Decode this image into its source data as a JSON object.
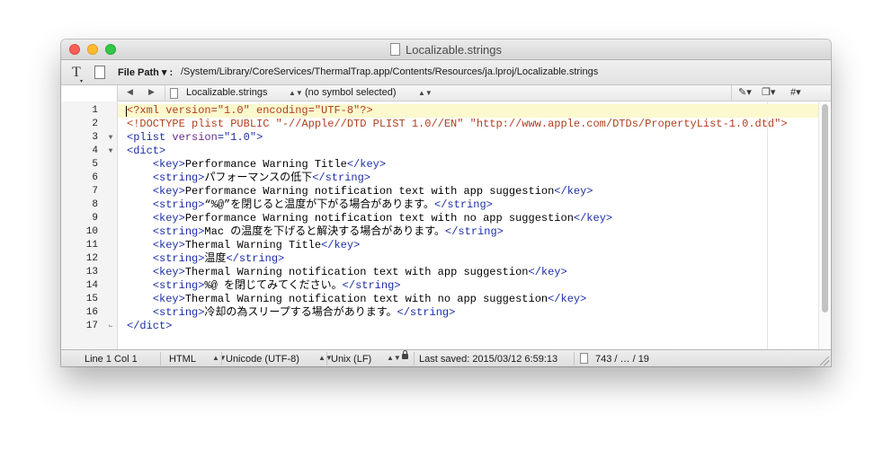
{
  "window": {
    "title": "Localizable.strings"
  },
  "pathbar": {
    "label": "File Path ▾ :",
    "value": "/System/Library/CoreServices/ThermalTrap.app/Contents/Resources/ja.lproj/Localizable.strings"
  },
  "navbar": {
    "file_name": "Localizable.strings",
    "symbol": "(no symbol selected)",
    "tool_icons": [
      "pencil-icon",
      "document-copy-icon",
      "hash-icon"
    ]
  },
  "editor": {
    "lines": [
      {
        "n": "1",
        "fold": "",
        "current": true,
        "tokens": [
          {
            "c": "pi",
            "t": "<?xml version=\"1.0\" encoding=\"UTF-8\"?>"
          }
        ]
      },
      {
        "n": "2",
        "fold": "",
        "current": false,
        "tokens": [
          {
            "c": "doctype",
            "t": "<!DOCTYPE plist PUBLIC \"-//Apple//DTD PLIST 1.0//EN\" \"http://www.apple.com/DTDs/PropertyList-1.0.dtd\">"
          }
        ]
      },
      {
        "n": "3",
        "fold": "open",
        "current": false,
        "tokens": [
          {
            "c": "tag",
            "t": "<plist "
          },
          {
            "c": "attr",
            "t": "version"
          },
          {
            "c": "tag",
            "t": "="
          },
          {
            "c": "str",
            "t": "\"1.0\""
          },
          {
            "c": "tag",
            "t": ">"
          }
        ]
      },
      {
        "n": "4",
        "fold": "open",
        "current": false,
        "tokens": [
          {
            "c": "tag",
            "t": "<dict>"
          }
        ]
      },
      {
        "n": "5",
        "fold": "",
        "current": false,
        "tokens": [
          {
            "c": "text",
            "t": "    "
          },
          {
            "c": "tag",
            "t": "<key>"
          },
          {
            "c": "text",
            "t": "Performance Warning Title"
          },
          {
            "c": "tag",
            "t": "</key>"
          }
        ]
      },
      {
        "n": "6",
        "fold": "",
        "current": false,
        "tokens": [
          {
            "c": "text",
            "t": "    "
          },
          {
            "c": "tag",
            "t": "<string>"
          },
          {
            "c": "text",
            "t": "パフォーマンスの低下"
          },
          {
            "c": "tag",
            "t": "</string>"
          }
        ]
      },
      {
        "n": "7",
        "fold": "",
        "current": false,
        "tokens": [
          {
            "c": "text",
            "t": "    "
          },
          {
            "c": "tag",
            "t": "<key>"
          },
          {
            "c": "text",
            "t": "Performance Warning notification text with app suggestion"
          },
          {
            "c": "tag",
            "t": "</key>"
          }
        ]
      },
      {
        "n": "8",
        "fold": "",
        "current": false,
        "tokens": [
          {
            "c": "text",
            "t": "    "
          },
          {
            "c": "tag",
            "t": "<string>"
          },
          {
            "c": "text",
            "t": "“%@”を閉じると温度が下がる場合があります。"
          },
          {
            "c": "tag",
            "t": "</string>"
          }
        ]
      },
      {
        "n": "9",
        "fold": "",
        "current": false,
        "tokens": [
          {
            "c": "text",
            "t": "    "
          },
          {
            "c": "tag",
            "t": "<key>"
          },
          {
            "c": "text",
            "t": "Performance Warning notification text with no app suggestion"
          },
          {
            "c": "tag",
            "t": "</key>"
          }
        ]
      },
      {
        "n": "10",
        "fold": "",
        "current": false,
        "tokens": [
          {
            "c": "text",
            "t": "    "
          },
          {
            "c": "tag",
            "t": "<string>"
          },
          {
            "c": "text",
            "t": "Mac の温度を下げると解決する場合があります。"
          },
          {
            "c": "tag",
            "t": "</string>"
          }
        ]
      },
      {
        "n": "11",
        "fold": "",
        "current": false,
        "tokens": [
          {
            "c": "text",
            "t": "    "
          },
          {
            "c": "tag",
            "t": "<key>"
          },
          {
            "c": "text",
            "t": "Thermal Warning Title"
          },
          {
            "c": "tag",
            "t": "</key>"
          }
        ]
      },
      {
        "n": "12",
        "fold": "",
        "current": false,
        "tokens": [
          {
            "c": "text",
            "t": "    "
          },
          {
            "c": "tag",
            "t": "<string>"
          },
          {
            "c": "text",
            "t": "温度"
          },
          {
            "c": "tag",
            "t": "</string>"
          }
        ]
      },
      {
        "n": "13",
        "fold": "",
        "current": false,
        "tokens": [
          {
            "c": "text",
            "t": "    "
          },
          {
            "c": "tag",
            "t": "<key>"
          },
          {
            "c": "text",
            "t": "Thermal Warning notification text with app suggestion"
          },
          {
            "c": "tag",
            "t": "</key>"
          }
        ]
      },
      {
        "n": "14",
        "fold": "",
        "current": false,
        "tokens": [
          {
            "c": "text",
            "t": "    "
          },
          {
            "c": "tag",
            "t": "<string>"
          },
          {
            "c": "text",
            "t": "%@ を閉じてみてください。"
          },
          {
            "c": "tag",
            "t": "</string>"
          }
        ]
      },
      {
        "n": "15",
        "fold": "",
        "current": false,
        "tokens": [
          {
            "c": "text",
            "t": "    "
          },
          {
            "c": "tag",
            "t": "<key>"
          },
          {
            "c": "text",
            "t": "Thermal Warning notification text with no app suggestion"
          },
          {
            "c": "tag",
            "t": "</key>"
          }
        ]
      },
      {
        "n": "16",
        "fold": "",
        "current": false,
        "tokens": [
          {
            "c": "text",
            "t": "    "
          },
          {
            "c": "tag",
            "t": "<string>"
          },
          {
            "c": "text",
            "t": "冷却の為スリープする場合があります。"
          },
          {
            "c": "tag",
            "t": "</string>"
          }
        ]
      },
      {
        "n": "17",
        "fold": "end",
        "current": false,
        "tokens": [
          {
            "c": "tag",
            "t": "</dict>"
          }
        ]
      }
    ]
  },
  "statusbar": {
    "position": "Line 1 Col 1",
    "language": "HTML",
    "encoding": "Unicode (UTF-8)",
    "line_endings": "Unix (LF)",
    "last_saved": "Last saved: 2015/03/12 6:59:13",
    "counts": "743 / … / 19"
  },
  "colors": {
    "tag": "#1c2fa6",
    "attr": "#6b2a8a",
    "processing_instruction": "#b03e1e",
    "current_line": "#fbf9cd"
  }
}
